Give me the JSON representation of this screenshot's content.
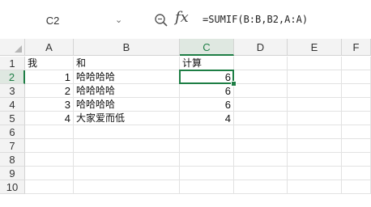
{
  "formula_bar": {
    "name_box": "C2",
    "zoom_icon": "zoom-in-icon",
    "fx_label": "fx",
    "formula": "=SUMIF(B:B,B2,A:A)"
  },
  "sheet": {
    "columns": [
      "A",
      "B",
      "C",
      "D",
      "E",
      "F"
    ],
    "rows": [
      "1",
      "2",
      "3",
      "4",
      "5",
      "6",
      "7",
      "8",
      "9",
      "10"
    ],
    "active_cell": "C2",
    "cells": {
      "A1": "我",
      "B1": "和",
      "C1": "计算",
      "A2": "1",
      "B2": "哈哈哈哈",
      "C2": "6",
      "A3": "2",
      "B3": "哈哈哈哈",
      "C3": "6",
      "A4": "3",
      "B4": "哈哈哈哈",
      "C4": "6",
      "A5": "4",
      "B5": "大家爱而低",
      "C5": "4"
    }
  },
  "colors": {
    "accent": "#1e7e45",
    "header_bg": "#f3f3f3",
    "active_header_bg": "#dfe8e1"
  }
}
